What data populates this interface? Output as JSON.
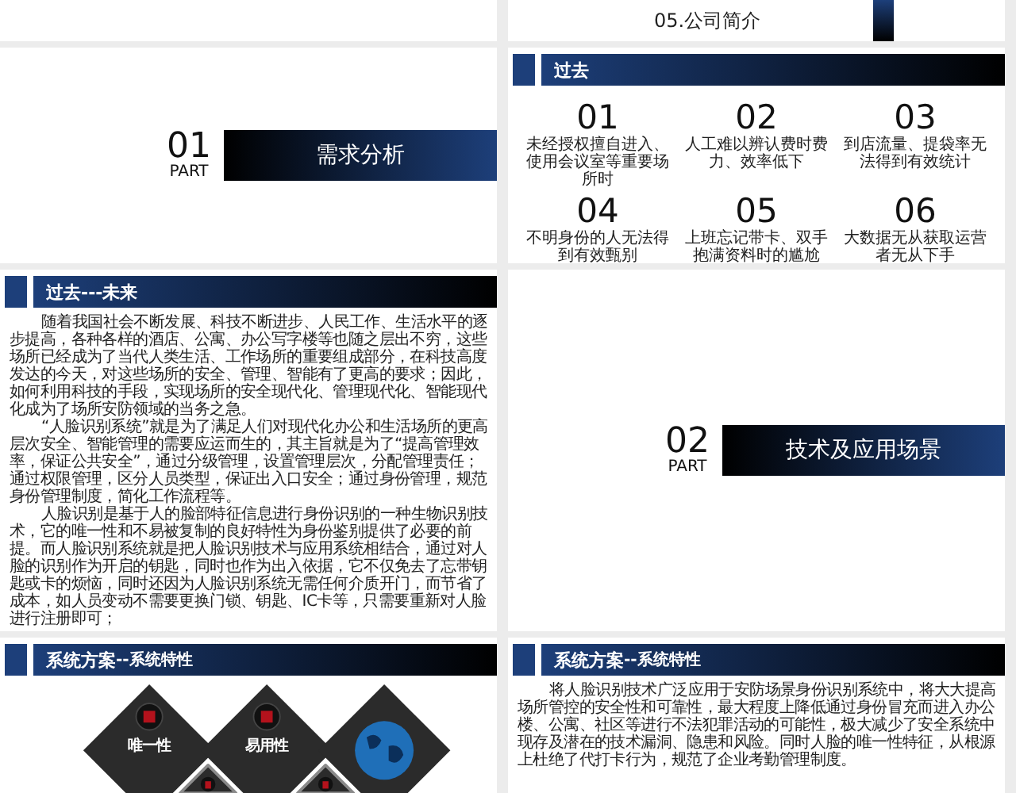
{
  "slides": [
    {
      "kind": "blank"
    },
    {
      "kind": "agenda_item",
      "label": "05.公司简介"
    },
    {
      "kind": "section",
      "number": "01",
      "part": "PART",
      "title": "需求分析"
    },
    {
      "kind": "grid",
      "title": "过去",
      "items": [
        {
          "number": "01",
          "caption": "未经授权擅自进入、使用会议室等重要场所时"
        },
        {
          "number": "02",
          "caption": "人工难以辨认费时费力、效率低下"
        },
        {
          "number": "03",
          "caption": "到店流量、提袋率无法得到有效统计"
        },
        {
          "number": "04",
          "caption": "不明身份的人无法得到有效甄别"
        },
        {
          "number": "05",
          "caption": "上班忘记带卡、双手抱满资料时的尴尬"
        },
        {
          "number": "06",
          "caption": "大数据无从获取运营者无从下手"
        }
      ]
    },
    {
      "kind": "text",
      "title": "过去---未来",
      "paragraphs": [
        "随着我国社会不断发展、科技不断进步、人民工作、生活水平的逐步提高，各种各样的酒店、公寓、办公写字楼等也随之层出不穷，这些场所已经成为了当代人类生活、工作场所的重要组成部分，在科技高度发达的今天，对这些场所的安全、管理、智能有了更高的要求；因此，如何利用科技的手段，实现场所的安全现代化、管理现代化、智能现代化成为了场所安防领域的当务之急。",
        "“人脸识别系统”就是为了满足人们对现代化办公和生活场所的更高层次安全、智能管理的需要应运而生的，其主旨就是为了“提高管理效率，保证公共安全”，通过分级管理，设置管理层次，分配管理责任；通过权限管理，区分人员类型，保证出入口安全；通过身份管理，规范身份管理制度，简化工作流程等。",
        "人脸识别是基于人的脸部特征信息进行身份识别的一种生物识别技术，它的唯一性和不易被复制的良好特性为身份鉴别提供了必要的前提。而人脸识别系统就是把人脸识别技术与应用系统相结合，通过对人脸的识别作为开启的钥匙，同时也作为出入依据，它不仅免去了忘带钥匙或卡的烦恼，同时还因为人脸识别系统无需任何介质开门，而节省了成本，如人员变动不需要更换门锁、钥匙、IC卡等，只需要重新对人脸进行注册即可；"
      ]
    },
    {
      "kind": "section",
      "number": "02",
      "part": "PART",
      "title": "技术及应用场景"
    },
    {
      "kind": "features",
      "title": "系统方案",
      "subtitle": "--系统特性",
      "features": [
        {
          "title": "唯一性"
        },
        {
          "title": "易用性"
        }
      ]
    },
    {
      "kind": "text",
      "title": "系统方案",
      "subtitle": "--系统特性",
      "paragraphs": [
        "将人脸识别技术广泛应用于安防场景身份识别系统中，将大大提高场所管控的安全性和可靠性，最大程度上降低通过身份冒充而进入办公楼、公寓、社区等进行不法犯罪活动的可能性，极大减少了安全系统中现存及潜在的技术漏洞、隐患和风险。同时人脸的唯一性特征，从根源上杜绝了代打卡行为，规范了企业考勤管理制度。"
      ]
    }
  ]
}
